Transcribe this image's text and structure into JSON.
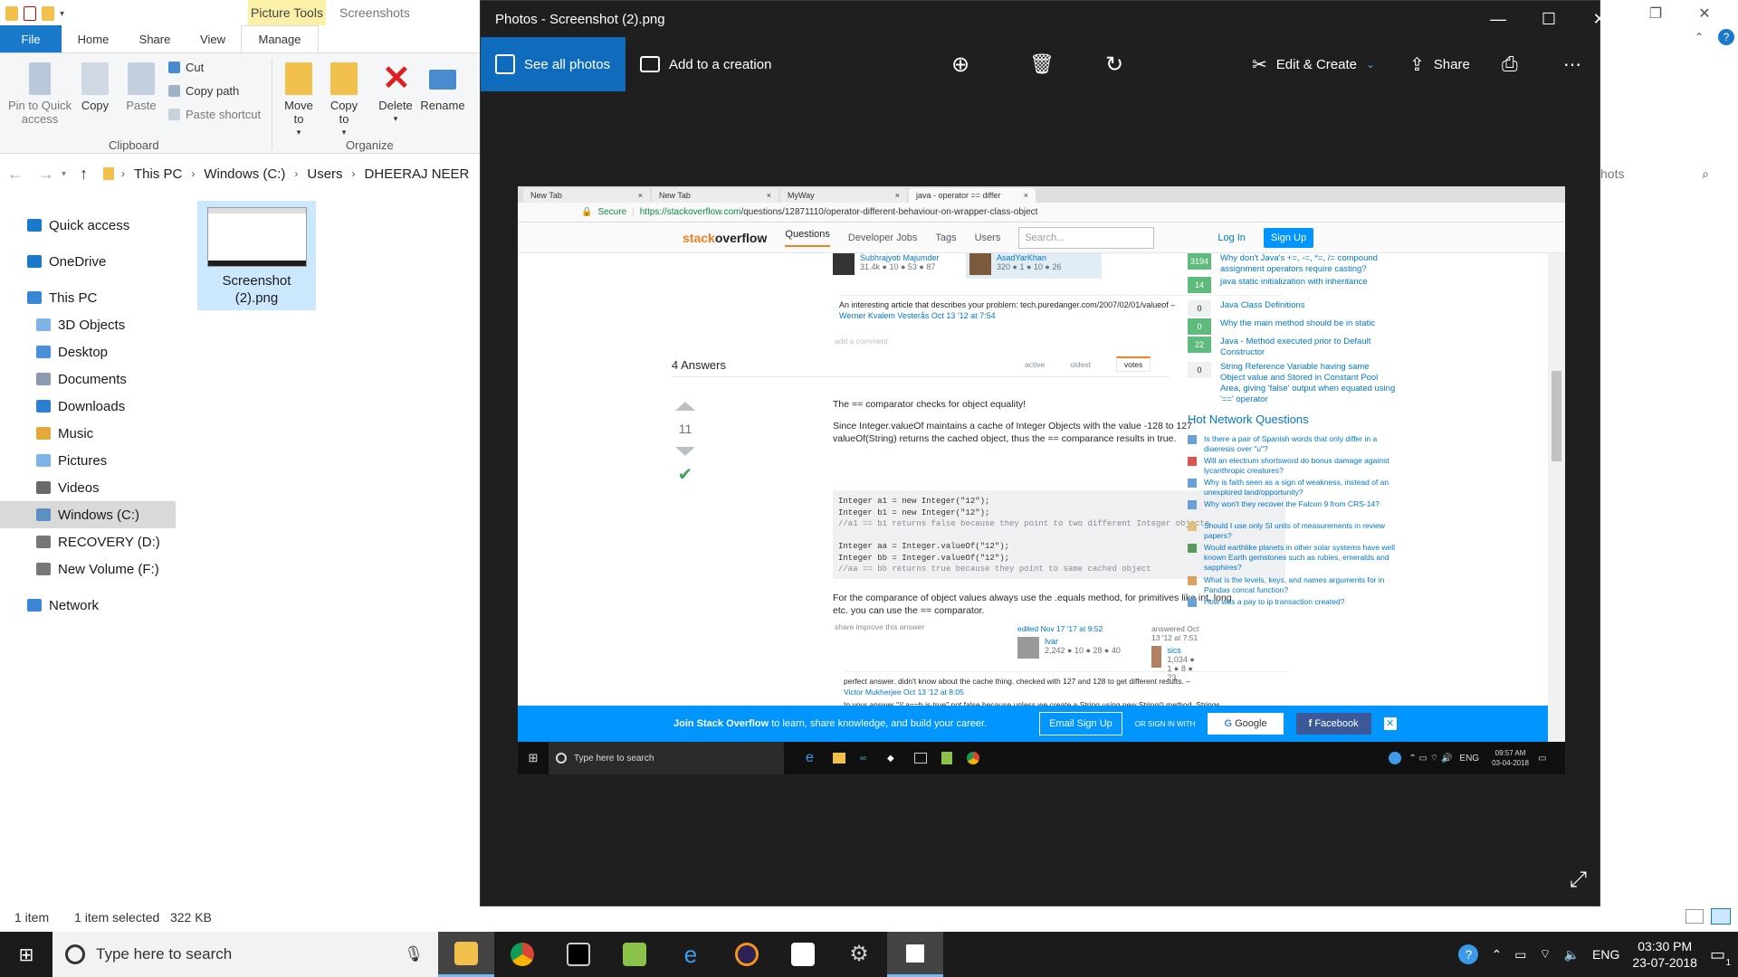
{
  "explorer": {
    "context_tab": "Picture Tools",
    "window_title": "Screenshots",
    "tabs": [
      "File",
      "Home",
      "Share",
      "View",
      "Manage"
    ],
    "clipboard": {
      "pin": "Pin to Quick access",
      "copy": "Copy",
      "paste": "Paste",
      "cut": "Cut",
      "copy_path": "Copy path",
      "paste_shortcut": "Paste shortcut",
      "label": "Clipboard"
    },
    "organize": {
      "move_to": "Move to",
      "copy_to": "Copy to",
      "delete": "Delete",
      "rename": "Rename",
      "label": "Organize"
    },
    "breadcrumb": [
      "This PC",
      "Windows (C:)",
      "Users",
      "DHEERAJ NEER"
    ],
    "search_placeholder": "hots",
    "nav": [
      {
        "label": "Quick access",
        "icon": "star-icon",
        "color": "#1979ca"
      },
      {
        "label": "OneDrive",
        "icon": "cloud-icon",
        "color": "#1979ca"
      },
      {
        "label": "This PC",
        "icon": "pc-icon",
        "color": "#3a87d8"
      },
      {
        "label": "3D Objects",
        "icon": "cube-icon",
        "color": "#7fb3e8"
      },
      {
        "label": "Desktop",
        "icon": "desktop-folder-icon",
        "color": "#4a90d9"
      },
      {
        "label": "Documents",
        "icon": "documents-folder-icon",
        "color": "#8a9bb0"
      },
      {
        "label": "Downloads",
        "icon": "downloads-folder-icon",
        "color": "#2f7fd0"
      },
      {
        "label": "Music",
        "icon": "music-folder-icon",
        "color": "#e6a83a"
      },
      {
        "label": "Pictures",
        "icon": "pictures-folder-icon",
        "color": "#7fb3e8"
      },
      {
        "label": "Videos",
        "icon": "videos-folder-icon",
        "color": "#6a6a6a"
      },
      {
        "label": "Windows (C:)",
        "icon": "drive-c-icon",
        "color": "#5c8fc4"
      },
      {
        "label": "RECOVERY (D:)",
        "icon": "drive-d-icon",
        "color": "#777777"
      },
      {
        "label": "New Volume (F:)",
        "icon": "drive-f-icon",
        "color": "#777777"
      },
      {
        "label": "Network",
        "icon": "network-icon",
        "color": "#3a87d8"
      }
    ],
    "file": {
      "name_line1": "Screenshot",
      "name_line2": "(2).png"
    },
    "status": {
      "items": "1 item",
      "selected": "1 item selected",
      "size": "322 KB"
    }
  },
  "photos": {
    "title": "Photos - Screenshot (2).png",
    "see_all": "See all photos",
    "add_creation": "Add to a creation",
    "edit_create": "Edit & Create",
    "share": "Share",
    "accent": "#0f6cbd",
    "toolbar_icons": [
      "zoom-in-icon",
      "delete-icon",
      "rotate-icon",
      "print-icon",
      "more-icon"
    ]
  },
  "shot": {
    "tabs": [
      "New Tab",
      "New Tab",
      "MyWay",
      "java - operator == differ"
    ],
    "url_secure": "Secure",
    "url_host": "https://stackoverflow.com",
    "url_path": "/questions/12871110/operator-different-behaviour-on-wrapper-class-object",
    "so": {
      "logo_a": "stack",
      "logo_b": "overflow",
      "nav": [
        "Questions",
        "Developer Jobs",
        "Tags",
        "Users"
      ],
      "search": "Search...",
      "login": "Log In",
      "signup": "Sign Up"
    },
    "q_user1": {
      "name": "Subhrajyoti Majumder",
      "rep": "31.4k ● 10 ● 53 ● 87"
    },
    "q_user2": {
      "name": "AsadYarKhan",
      "rep": "320 ● 1 ● 10 ● 26"
    },
    "comment1": "An interesting article that describes your problem: tech.puredanger.com/2007/02/01/valueof –",
    "comment1_by": "Werner Kvalem Vesterås Oct 13 '12 at 7:54",
    "add_comment": "add a comment",
    "answers_title": "4 Answers",
    "sort": [
      "active",
      "oldest",
      "votes"
    ],
    "vote_count": "11",
    "ans_p1": "The == comparator checks for object equality!",
    "ans_p2": "Since Integer.valueOf maintains a cache of Integer Objects with the value -128 to 127",
    "ans_p3": "valueOf(String) returns the cached object, thus the == comparance results in true.",
    "code": [
      "Integer a1 = new Integer(\"12\");",
      "Integer b1 = new Integer(\"12\");",
      "//a1 == b1 returns false because they point to two different Integer objects",
      "",
      "Integer aa = Integer.valueOf(\"12\");",
      "Integer bb = Integer.valueOf(\"12\");",
      "//aa == bb returns true because they point to same cached object"
    ],
    "ans_p4": "For the comparance of object values always use the .equals method, for primitives like int, long",
    "ans_p5": "etc. you can use the == comparator.",
    "share_links": "share  improve this answer",
    "edited": "edited Nov 17 '17 at 9:52",
    "editor": {
      "name": "Ivar",
      "rep": "2,242 ● 10 ● 28 ● 40"
    },
    "answered": "answered Oct 13 '12 at 7:51",
    "answerer": {
      "name": "sics",
      "rep": "1,034 ● 1 ● 8 ● 23"
    },
    "comment2": "perfect answer. didn't know about the cache thing. checked with 127 and 128 to get different results. –",
    "comment2_by": "Victor Mukherjee Oct 13 '12 at 8:05",
    "comment3": "In your answer \"// a==b is true\" not false because unless we create a String using new String() method, Strings",
    "side": [
      {
        "count": "3194",
        "green": true,
        "text": "Why don't Java's +=, -=, *=, /= compound assignment operators require casting?"
      },
      {
        "count": "14",
        "green": true,
        "text": "java static initialization with inheritance"
      },
      {
        "count": "0",
        "green": false,
        "text": "Java Class Definitions"
      },
      {
        "count": "0",
        "green": true,
        "text": "Why the main method should be in static"
      },
      {
        "count": "22",
        "green": true,
        "text": "Java - Method executed prior to Default Constructor"
      },
      {
        "count": "0",
        "green": false,
        "text": "String Reference Variable having same Object value and Stored in Constant Pool Area, giving 'false' output when equated using '==' operator"
      }
    ],
    "hnq_title": "Hot Network Questions",
    "hnq": [
      "Is there a pair of Spanish words that only differ in a diaeresis over \"u\"?",
      "Will an electrum shortsword do bonus damage against lycanthropic creatures?",
      "Why is faith seen as a sign of weakness, instead of an unexplored land/opportunity?",
      "Why won't they recover the Falcon 9 from CRS-14?",
      "Should I use only SI units of measurements in review papers?",
      "Would earthlike planets in other solar systems have well known Earth gemstones such as rubies, emeralds and sapphires?",
      "What is the levels, keys, and names arguments for in Pandas concat function?",
      "How was a pay to ip transaction created?"
    ],
    "join": {
      "lead": "Join Stack Overflow",
      "rest": "to learn, share knowledge, and build your career.",
      "email": "Email Sign Up",
      "or": "OR SIGN IN WITH",
      "google": "Google",
      "facebook": "Facebook"
    },
    "taskbar": {
      "search": "Type here to search",
      "lang": "ENG",
      "time": "09:57 AM",
      "date": "03-04-2018"
    }
  },
  "taskbar": {
    "search": "Type here to search",
    "lang": "ENG",
    "time": "03:30 PM",
    "date": "23-07-2018",
    "notif_count": "1"
  }
}
